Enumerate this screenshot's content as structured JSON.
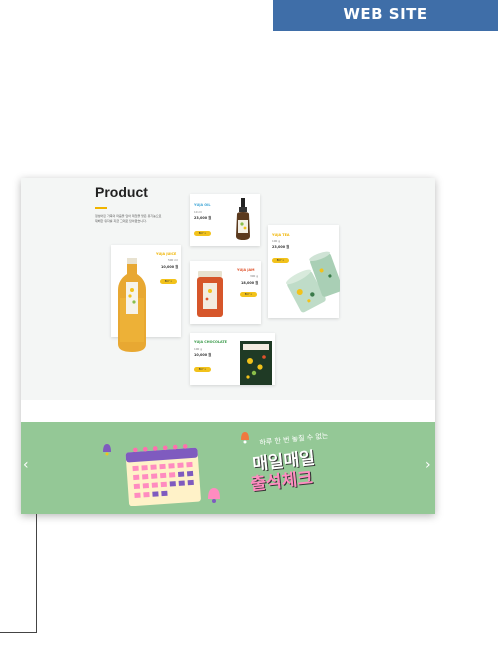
{
  "badge": {
    "label": "WEB SITE"
  },
  "product_section": {
    "title": "Product",
    "description": "정성어린 가족의 마음을 담아 제철을 맞은 유기농으로 재배한 유자를 지금 그대로 담아왔습니다."
  },
  "products": [
    {
      "name": "YUJA OIL",
      "volume": "10 ml",
      "price": "23,000 원",
      "button": "BUY >",
      "accent": "#3fa6d6"
    },
    {
      "name": "YUJA TEA",
      "volume": "100 g",
      "price": "23,000 원",
      "button": "BUY >",
      "accent": "#f0b400"
    },
    {
      "name": "YUJA JUICE",
      "volume": "500 ml",
      "price": "10,000 원",
      "button": "BUY >",
      "accent": "#f0b400"
    },
    {
      "name": "YUJA JAM",
      "volume": "300 g",
      "price": "18,000 원",
      "button": "BUY >",
      "accent": "#e0522b"
    },
    {
      "name": "YUJA CHOCOLATE",
      "volume": "100 g",
      "price": "10,000 원",
      "button": "BUY >",
      "accent": "#3a9a4a"
    }
  ],
  "banner": {
    "subtitle": "하루 한 번 놓칠 수 없는",
    "headline_1": "매일매일",
    "headline_2": "출석체크",
    "prev_icon": "chevron-left-icon",
    "next_icon": "chevron-right-icon",
    "bg": "#94c896",
    "pink": "#ff6fae",
    "purple": "#7f5bbf"
  }
}
